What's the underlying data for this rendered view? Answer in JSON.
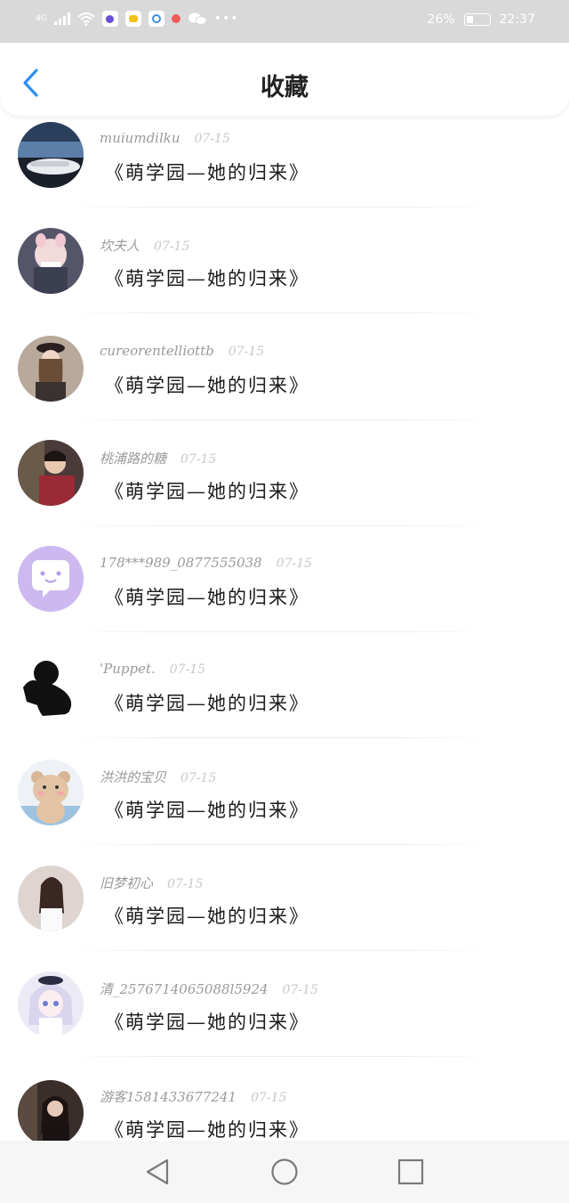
{
  "status_bar": {
    "network": "4G",
    "battery": "26%",
    "time": "22:37",
    "icons": [
      "signal-icon",
      "wifi-icon",
      "app-icon",
      "app-icon",
      "app-icon",
      "notification-icon",
      "wechat-icon",
      "more-dots-icon"
    ]
  },
  "header": {
    "title": "收藏",
    "back_icon": "chevron-left-icon"
  },
  "items": [
    {
      "user": "muiumdilku",
      "date": "07-15",
      "title": "《萌学园—她的归来》",
      "avatar_color": "#2a3f5c"
    },
    {
      "user": "坎夫人",
      "date": "07-15",
      "title": "《萌学园—她的归来》",
      "avatar_color": "#6b6b7a"
    },
    {
      "user": "cureorentelliottb",
      "date": "07-15",
      "title": "《萌学园—她的归来》",
      "avatar_color": "#b9a99a"
    },
    {
      "user": "桃浦路的糖",
      "date": "07-15",
      "title": "《萌学园—她的归来》",
      "avatar_color": "#8a3a3a"
    },
    {
      "user": "178***989_0877555038",
      "date": "07-15",
      "title": "《萌学园—她的归来》",
      "avatar_color": "#cdb8f0"
    },
    {
      "user": "'Puppet.",
      "date": "07-15",
      "title": "《萌学园—她的归来》",
      "avatar_color": "#111111"
    },
    {
      "user": "洪洪的宝贝",
      "date": "07-15",
      "title": "《萌学园—她的归来》",
      "avatar_color": "#e8d3bd"
    },
    {
      "user": "旧梦初心",
      "date": "07-15",
      "title": "《萌学园—她的归来》",
      "avatar_color": "#d8c7c2"
    },
    {
      "user": "清_2576714065088l5924",
      "date": "07-15",
      "title": "《萌学园—她的归来》",
      "avatar_color": "#d9d5ee"
    },
    {
      "user": "游客1581433677241",
      "date": "07-15",
      "title": "《萌学园—她的归来》",
      "avatar_color": "#3a2e2b"
    }
  ],
  "nav_bar": {
    "icons": [
      "back-triangle-icon",
      "home-circle-icon",
      "recents-square-icon"
    ]
  },
  "colors": {
    "accent": "#2f8ff5",
    "status_bg": "#d9d9d9",
    "username": "#9a9a9a",
    "date": "#c8c8c8"
  }
}
